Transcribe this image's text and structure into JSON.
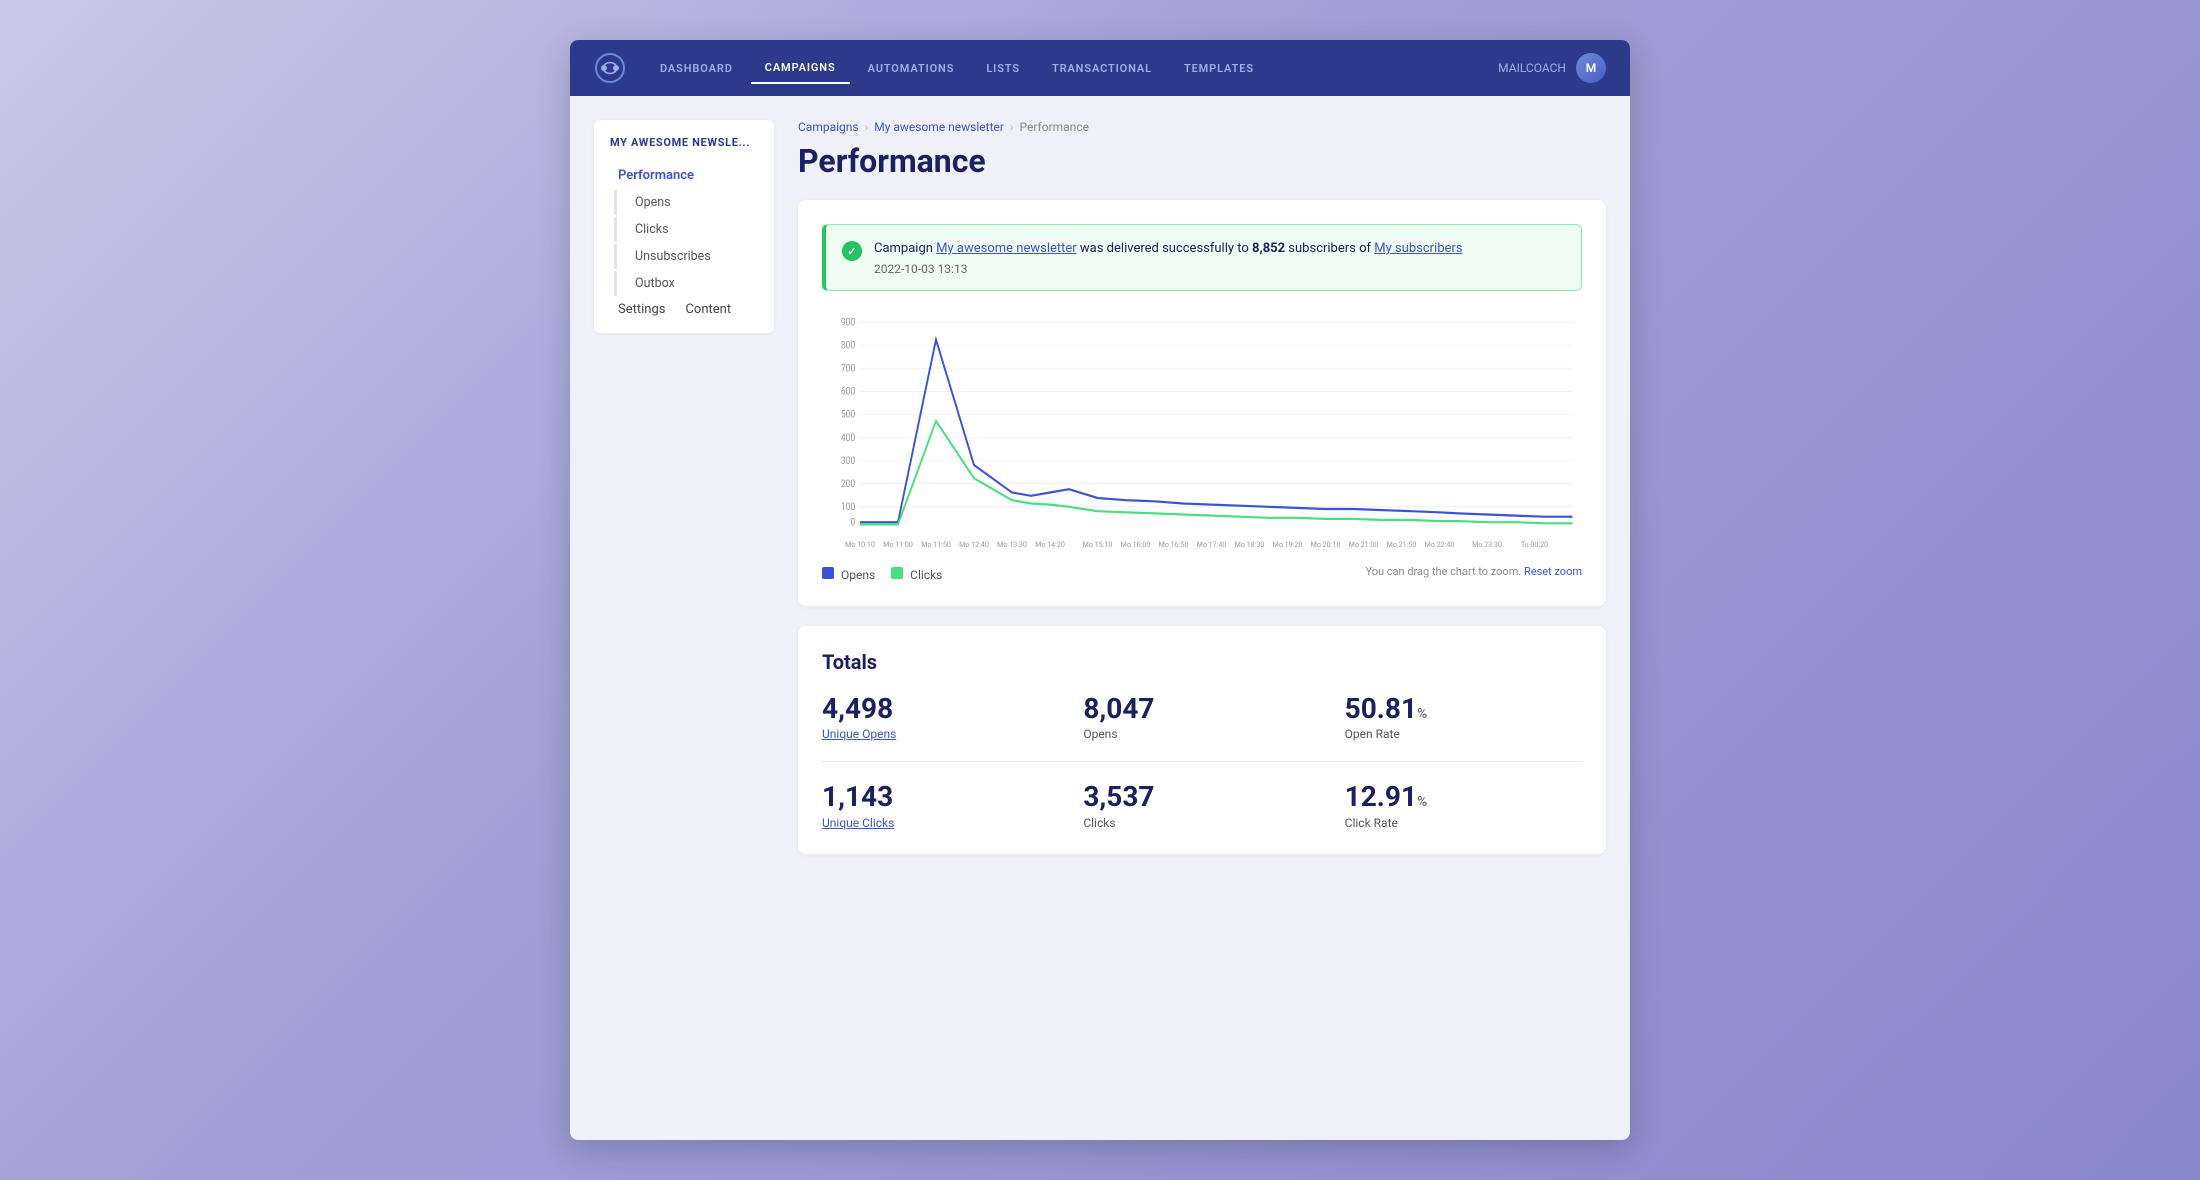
{
  "nav": {
    "logo_alt": "Mailcoach logo",
    "items": [
      {
        "label": "DASHBOARD",
        "active": false
      },
      {
        "label": "CAMPAIGNS",
        "active": true
      },
      {
        "label": "AUTOMATIONS",
        "active": false
      },
      {
        "label": "LISTS",
        "active": false
      },
      {
        "label": "TRANSACTIONAL",
        "active": false
      },
      {
        "label": "TEMPLATES",
        "active": false
      }
    ],
    "user_label": "MAILCOACH",
    "avatar_initials": "M"
  },
  "breadcrumb": {
    "items": [
      "Campaigns",
      "My awesome newsletter",
      "Performance"
    ]
  },
  "page": {
    "title": "Performance"
  },
  "sidebar": {
    "title": "MY AWESOME NEWSLE...",
    "items": [
      {
        "label": "Performance",
        "active": true,
        "type": "section"
      },
      {
        "label": "Opens",
        "active": false,
        "type": "sub"
      },
      {
        "label": "Clicks",
        "active": false,
        "type": "sub"
      },
      {
        "label": "Unsubscribes",
        "active": false,
        "type": "sub"
      },
      {
        "label": "Outbox",
        "active": false,
        "type": "sub"
      },
      {
        "label": "Settings",
        "active": false,
        "type": "section"
      },
      {
        "label": "Content",
        "active": false,
        "type": "section"
      }
    ]
  },
  "alert": {
    "campaign_text": "Campaign ",
    "campaign_name": "My awesome newsletter",
    "middle_text": " was delivered successfully to ",
    "subscribers_count": "8,852",
    "subscribers_text": " subscribers of ",
    "list_name": "My subscribers",
    "date": "2022-10-03 13:13"
  },
  "chart": {
    "x_labels": [
      "Mo 10:10",
      "Mo 11:00",
      "Mo 11:50",
      "Mo 12:40",
      "Mo 13:30",
      "Mo 14:20",
      "Mo 15:10",
      "Mo 16:00",
      "Mo 16:50",
      "Mo 17:40",
      "Mo 18:30",
      "Mo 19:20",
      "Mo 20:10",
      "Mo 21:00",
      "Mo 21:50",
      "Mo 22:40",
      "Mo 23:30",
      "Tu 00:20"
    ],
    "y_labels": [
      "900",
      "800",
      "700",
      "600",
      "500",
      "400",
      "300",
      "200",
      "100",
      "0"
    ],
    "legend": [
      {
        "label": "Opens",
        "color": "#3d52d5"
      },
      {
        "label": "Clicks",
        "color": "#4ade80"
      }
    ],
    "hint": "You can drag the chart to zoom.",
    "reset_zoom": "Reset zoom"
  },
  "totals": {
    "title": "Totals",
    "rows": [
      [
        {
          "value": "4,498",
          "label": "Unique Opens",
          "is_link": true
        },
        {
          "value": "8,047",
          "label": "Opens",
          "is_link": false
        },
        {
          "value": "50.81",
          "unit": "%",
          "label": "Open Rate",
          "is_link": false
        }
      ],
      [
        {
          "value": "1,143",
          "label": "Unique Clicks",
          "is_link": true
        },
        {
          "value": "3,537",
          "label": "Clicks",
          "is_link": false
        },
        {
          "value": "12.91",
          "unit": "%",
          "label": "Click Rate",
          "is_link": false
        }
      ]
    ]
  }
}
